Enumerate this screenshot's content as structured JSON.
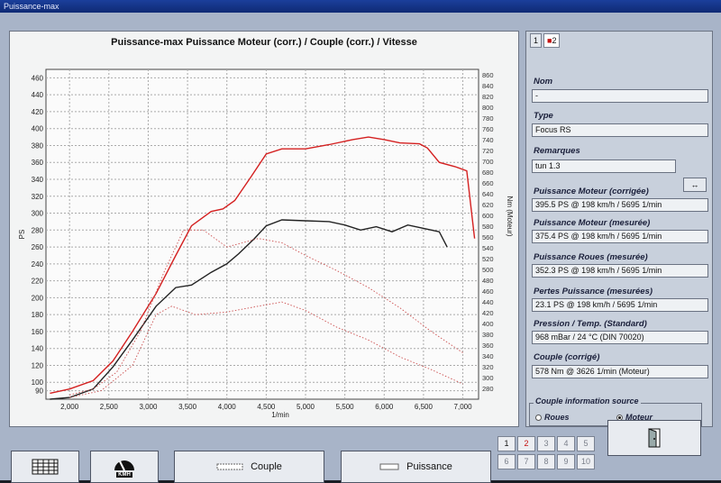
{
  "window": {
    "title": "Puissance-max"
  },
  "chart": {
    "title": "Puissance-max Puissance Moteur (corr.) / Couple (corr.) / Vitesse",
    "y_left_label": "PS",
    "y_right_label": "Nm (Moteur)",
    "x_unit_label": "1/min"
  },
  "chart_data": {
    "type": "line",
    "title": "Puissance-max Puissance Moteur (corr.) / Couple (corr.) / Vitesse",
    "xlabel": "1/min",
    "ylabel": "PS",
    "ylabel_right": "Nm (Moteur)",
    "xlim": [
      1700,
      7200
    ],
    "ylim": [
      80,
      470
    ],
    "ylim_right": [
      260,
      870
    ],
    "x_ticks": [
      "2,000",
      "2,500",
      "3,000",
      "3,500",
      "4,000",
      "4,500",
      "5,000",
      "5,500",
      "6,000",
      "6,500",
      "7,000"
    ],
    "y_ticks_left": [
      "90",
      "100",
      "120",
      "140",
      "160",
      "180",
      "200",
      "220",
      "240",
      "260",
      "280",
      "300",
      "320",
      "340",
      "360",
      "380",
      "400",
      "420",
      "440",
      "460"
    ],
    "y_ticks_right": [
      "280",
      "300",
      "320",
      "340",
      "360",
      "380",
      "400",
      "420",
      "440",
      "460",
      "480",
      "500",
      "520",
      "540",
      "560",
      "580",
      "600",
      "620",
      "640",
      "660",
      "680",
      "700",
      "720",
      "740",
      "760",
      "780",
      "800",
      "820",
      "840",
      "860"
    ],
    "grid": true,
    "series": [
      {
        "name": "Puissance",
        "color": "#d42020",
        "style": "solid",
        "axis": "left",
        "x": [
          1750,
          2000,
          2300,
          2550,
          2800,
          3100,
          3350,
          3550,
          3800,
          3950,
          4100,
          4300,
          4500,
          4700,
          5000,
          5300,
          5600,
          5800,
          6000,
          6200,
          6450,
          6550,
          6700,
          6900,
          7050,
          7150
        ],
        "y": [
          87,
          92,
          102,
          125,
          160,
          205,
          250,
          285,
          302,
          305,
          315,
          342,
          370,
          376,
          376,
          381,
          387,
          390,
          387,
          383,
          382,
          377,
          360,
          355,
          350,
          270
        ]
      },
      {
        "name": "Couple",
        "color": "#222222",
        "style": "solid",
        "axis": "left",
        "x": [
          1750,
          2000,
          2300,
          2550,
          2800,
          3100,
          3350,
          3550,
          3800,
          4000,
          4150,
          4350,
          4500,
          4700,
          5000,
          5300,
          5500,
          5700,
          5900,
          6100,
          6300,
          6500,
          6700,
          6800
        ],
        "y": [
          80,
          82,
          92,
          118,
          150,
          190,
          212,
          215,
          230,
          240,
          252,
          270,
          285,
          292,
          291,
          290,
          286,
          280,
          284,
          278,
          286,
          282,
          278,
          260
        ]
      },
      {
        "name": "Couple perte",
        "color": "#cc5050",
        "style": "dotted",
        "axis": "left",
        "x": [
          2000,
          2300,
          2600,
          2900,
          3200,
          3450,
          3700,
          4000,
          4400,
          4700,
          5000,
          5400,
          5800,
          6200,
          6600,
          7000
        ],
        "y": [
          85,
          92,
          112,
          160,
          230,
          280,
          280,
          260,
          270,
          265,
          250,
          232,
          212,
          188,
          160,
          135
        ]
      },
      {
        "name": "Pertes",
        "color": "#cc5050",
        "style": "dotted",
        "axis": "left",
        "x": [
          2000,
          2400,
          2800,
          3100,
          3300,
          3600,
          4000,
          4400,
          4700,
          5000,
          5400,
          5800,
          6200,
          6600,
          7000
        ],
        "y": [
          82,
          90,
          120,
          180,
          190,
          180,
          183,
          190,
          195,
          185,
          165,
          150,
          130,
          115,
          98
        ]
      }
    ]
  },
  "tabs": [
    {
      "label": "1"
    },
    {
      "label": "2"
    }
  ],
  "panel": {
    "nom_label": "Nom",
    "nom_value": "-",
    "type_label": "Type",
    "type_value": "Focus RS",
    "remarques_label": "Remarques",
    "remarques_value": "tun 1.3",
    "remarques_button": "↔",
    "pm_corr_label": "Puissance Moteur (corrigée)",
    "pm_corr_value": "395.5 PS @ 198 km/h / 5695 1/min",
    "pm_mes_label": "Puissance Moteur (mesurée)",
    "pm_mes_value": "375.4 PS @ 198 km/h / 5695 1/min",
    "pr_mes_label": "Puissance Roues (mesurée)",
    "pr_mes_value": "352.3 PS @ 198 km/h / 5695 1/min",
    "pertes_label": "Pertes Puissance (mesurées)",
    "pertes_value": "23.1 PS @ 198 km/h / 5695 1/min",
    "pression_label": "Pression / Temp. (Standard)",
    "pression_value": "968 mBar / 24 °C (DIN 70020)",
    "couple_label": "Couple (corrigé)",
    "couple_value": "578 Nm @ 3626 1/min (Moteur)",
    "source_label": "Couple information source",
    "source_options": [
      "Roues",
      "Moteur"
    ],
    "source_selected": "Moteur"
  },
  "bottom": {
    "couple_label": "Couple",
    "puissance_label": "Puissance",
    "kmh_label": "KMH"
  },
  "pager": {
    "numbers": [
      "1",
      "2",
      "3",
      "4",
      "5",
      "6",
      "7",
      "8",
      "9",
      "10"
    ],
    "active": "2"
  }
}
